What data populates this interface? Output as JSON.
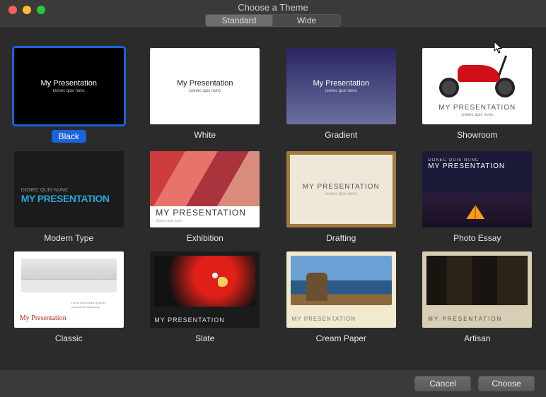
{
  "window": {
    "title": "Choose a Theme"
  },
  "segmented": {
    "standard": "Standard",
    "wide": "Wide",
    "active": "standard"
  },
  "sample": {
    "title": "My Presentation",
    "subtitle": "Donec quis nunc",
    "title_upper": "MY PRESENTATION",
    "subtitle_upper": "DONEC QUIS NUNC",
    "subtitle_italic": "Donec quis nunc",
    "lorem_cols": "Lorem ipsum dolor sit amet, consectetur adipiscing."
  },
  "themes": [
    {
      "id": "black",
      "label": "Black",
      "selected": true
    },
    {
      "id": "white",
      "label": "White"
    },
    {
      "id": "gradient",
      "label": "Gradient"
    },
    {
      "id": "showroom",
      "label": "Showroom"
    },
    {
      "id": "modern-type",
      "label": "Modern Type"
    },
    {
      "id": "exhibition",
      "label": "Exhibition"
    },
    {
      "id": "drafting",
      "label": "Drafting"
    },
    {
      "id": "photo-essay",
      "label": "Photo Essay"
    },
    {
      "id": "classic",
      "label": "Classic"
    },
    {
      "id": "slate",
      "label": "Slate"
    },
    {
      "id": "cream-paper",
      "label": "Cream Paper"
    },
    {
      "id": "artisan",
      "label": "Artisan"
    }
  ],
  "footer": {
    "cancel": "Cancel",
    "choose": "Choose"
  }
}
